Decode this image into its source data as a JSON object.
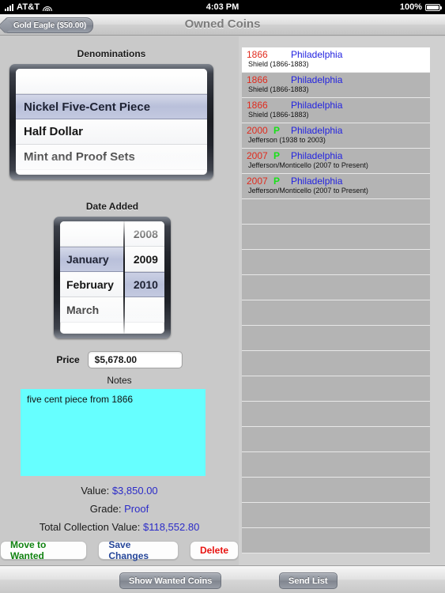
{
  "statusbar": {
    "carrier": "AT&T",
    "time": "4:03 PM",
    "battery": "100%",
    "signal_icon": "signal-bars-icon",
    "wifi_icon": "wifi-icon",
    "battery_icon": "battery-full-icon"
  },
  "navbar": {
    "back_label": "Gold Eagle ($50.00)",
    "title": "Owned Coins",
    "back_icon": "chevron-left-icon"
  },
  "denominations": {
    "label": "Denominations",
    "rows": [
      {
        "text": "",
        "selected": false
      },
      {
        "text": "Nickel Five-Cent Piece",
        "selected": true
      },
      {
        "text": "Half Dollar",
        "selected": false
      },
      {
        "text": "Mint and Proof Sets",
        "selected": false
      }
    ]
  },
  "date_added": {
    "label": "Date Added",
    "months": [
      {
        "text": "",
        "selected": false
      },
      {
        "text": "January",
        "selected": true
      },
      {
        "text": "February",
        "selected": false
      },
      {
        "text": "March",
        "selected": false
      }
    ],
    "years": [
      {
        "text": "2008",
        "selected": false
      },
      {
        "text": "2009",
        "selected": false
      },
      {
        "text": "2010",
        "selected": true
      },
      {
        "text": "",
        "selected": false
      }
    ]
  },
  "price": {
    "label": "Price",
    "value": "$5,678.00",
    "placeholder": "Price"
  },
  "notes": {
    "label": "Notes",
    "value": "five cent piece from 1866",
    "placeholder": "Notes",
    "background_color": "#66ffff"
  },
  "summary": {
    "value_label": "Value: ",
    "value_amount": "$3,850.00",
    "grade_label": "Grade: ",
    "grade_value": "Proof",
    "total_label": "Total Collection Value: ",
    "total_amount": "$118,552.80",
    "accent_color": "#2b2bc8"
  },
  "actions": {
    "move_to_wanted": "Move to Wanted",
    "save_changes": "Save Changes",
    "delete": "Delete",
    "move_color": "#128312",
    "save_color": "#27479a",
    "delete_color": "#e8120f"
  },
  "toolbar": {
    "show_wanted": "Show Wanted Coins",
    "send_list": "Send List"
  },
  "coin_list": {
    "year_color": "#e02b1e",
    "mint_mark_color": "#19e019",
    "city_color": "#2222e0",
    "rows": [
      {
        "year": "1866",
        "mint_mark": "",
        "city": "Philadelphia",
        "description": "Shield (1866-1883)",
        "selected": true
      },
      {
        "year": "1866",
        "mint_mark": "",
        "city": "Philadelphia",
        "description": "Shield (1866-1883)",
        "selected": false
      },
      {
        "year": "1866",
        "mint_mark": "",
        "city": "Philadelphia",
        "description": "Shield (1866-1883)",
        "selected": false
      },
      {
        "year": "2000",
        "mint_mark": "P",
        "city": "Philadelphia",
        "description": "Jefferson (1938 to 2003)",
        "selected": false
      },
      {
        "year": "2007",
        "mint_mark": "P",
        "city": "Philadelphia",
        "description": "Jefferson/Monticello (2007 to Present)",
        "selected": false
      },
      {
        "year": "2007",
        "mint_mark": "P",
        "city": "Philadelphia",
        "description": "Jefferson/Monticello (2007 to Present)",
        "selected": false
      }
    ],
    "empty_row_count": 14
  }
}
